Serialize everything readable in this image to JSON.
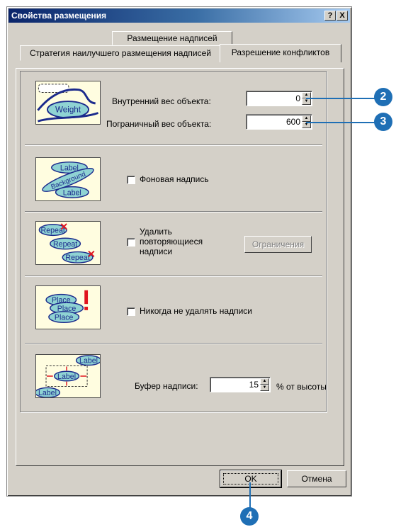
{
  "window": {
    "title": "Свойства размещения",
    "help_button": "?",
    "close_button": "X"
  },
  "tabs": {
    "top_row": "Размещение надписей",
    "bottom_left": "Стратегия наилучшего размещения надписей",
    "active": "Разрешение конфликтов"
  },
  "weights": {
    "inner_label": "Внутренний вес объекта:",
    "inner_value": "0",
    "border_label": "Пограничный вес объекта:",
    "border_value": "600"
  },
  "background_label": {
    "checkbox_label": "Фоновая надпись",
    "checked": false
  },
  "remove_duplicates": {
    "checkbox_label_line1": "Удалить",
    "checkbox_label_line2": "повторяющиеся",
    "checkbox_label_line3": "надписи",
    "checked": false,
    "limits_button": "Ограничения"
  },
  "never_remove": {
    "checkbox_label": "Никогда не удалять надписи",
    "checked": false
  },
  "buffer": {
    "label": "Буфер надписи:",
    "value": "15",
    "unit": "% от высоты"
  },
  "buttons": {
    "ok": "OK",
    "cancel": "Отмена"
  },
  "illustrations": {
    "weight": "Weight",
    "background_top": "Label",
    "background_middle": "Background",
    "background_bottom": "Label",
    "repeat1": "Repeat",
    "repeat2": "Repeat",
    "repeat3": "Repeat",
    "place1": "Place",
    "place2": "Place",
    "place3": "Place",
    "buffer_top": "Label",
    "buffer_center": "Label",
    "buffer_bottom": "Label"
  },
  "callouts": {
    "c2": "2",
    "c3": "3",
    "c4": "4"
  },
  "colors": {
    "callout": "#1f6fb5",
    "label_fill": "#8fd3d3",
    "illustration_bg": "#fffde0",
    "accent_red": "#e0141e"
  }
}
